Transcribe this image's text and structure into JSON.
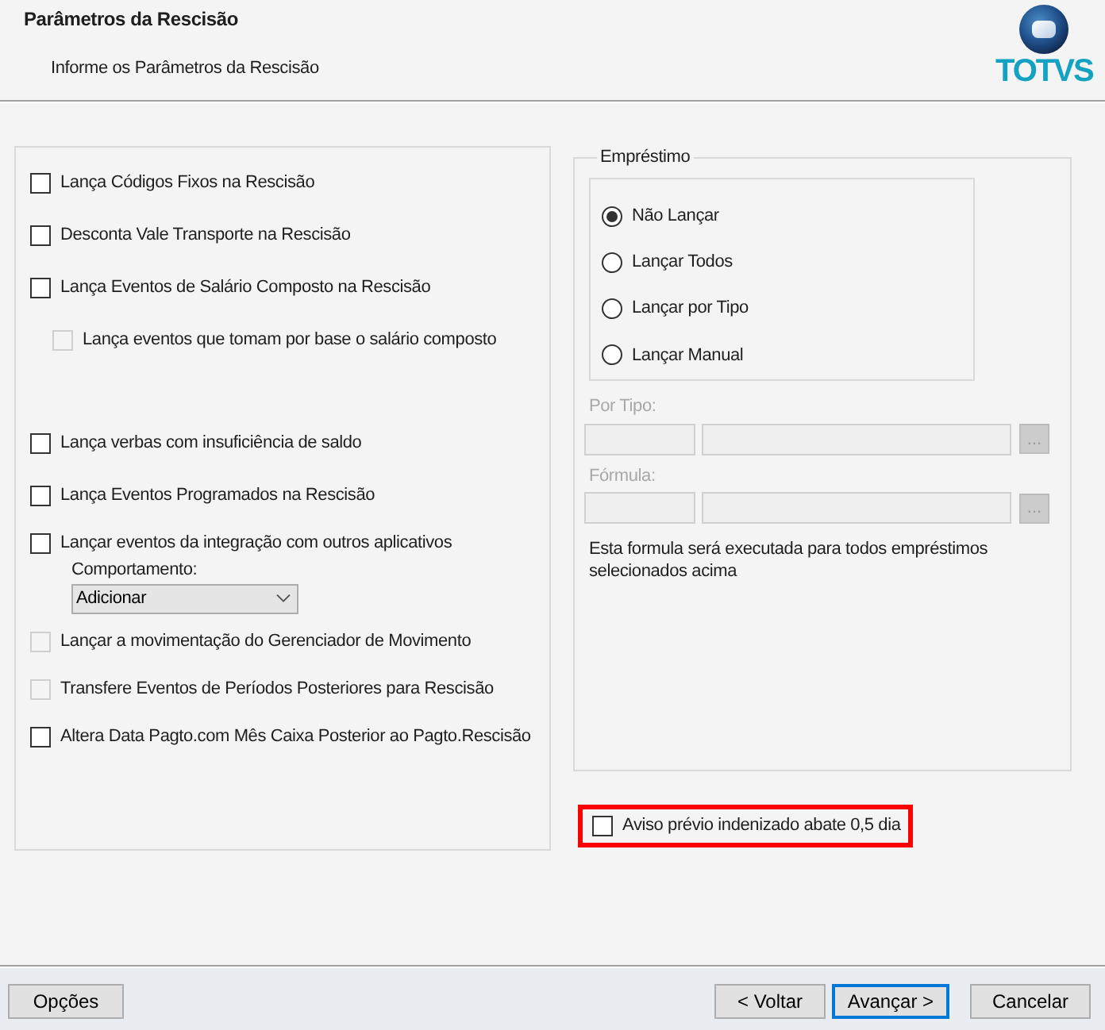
{
  "header": {
    "title": "Parâmetros da Rescisão",
    "subtitle": "Informe os Parâmetros da Rescisão",
    "logo_text": "TOTVS"
  },
  "options": [
    {
      "kind": "checkbox",
      "label": "Lança Códigos Fixos na Rescisão",
      "checked": false,
      "disabled": false
    },
    {
      "kind": "checkbox",
      "label": "Desconta Vale Transporte na Rescisão",
      "checked": false,
      "disabled": false
    },
    {
      "kind": "checkbox",
      "label": "Lança Eventos de Salário Composto na Rescisão",
      "checked": false,
      "disabled": false,
      "children": [
        {
          "kind": "checkbox",
          "label": "Lança eventos que tomam por base o salário composto",
          "checked": false,
          "disabled": true
        }
      ]
    },
    {
      "kind": "checkbox",
      "label": "Lança verbas com insuficiência de saldo",
      "checked": false,
      "disabled": false
    },
    {
      "kind": "checkbox",
      "label": "Lança Eventos Programados na Rescisão",
      "checked": false,
      "disabled": false
    },
    {
      "kind": "checkbox",
      "label": "Lançar eventos da integração com outros aplicativos",
      "checked": false,
      "disabled": false,
      "children": [
        {
          "kind": "dropdown",
          "label": "Comportamento:",
          "value": "Adicionar"
        }
      ]
    },
    {
      "kind": "checkbox",
      "label": "Lançar a movimentação do Gerenciador de Movimento",
      "checked": false,
      "disabled": true
    },
    {
      "kind": "checkbox",
      "label": "Transfere Eventos de Períodos Posteriores para Rescisão",
      "checked": false,
      "disabled": true
    },
    {
      "kind": "checkbox",
      "label": "Altera Data Pagto.com Mês Caixa Posterior ao Pagto.Rescisão",
      "checked": false,
      "disabled": false
    }
  ],
  "loan": {
    "title": "Empréstimo",
    "radios": [
      {
        "label": "Não Lançar",
        "selected": true
      },
      {
        "label": "Lançar Todos",
        "selected": false
      },
      {
        "label": "Lançar por Tipo",
        "selected": false
      },
      {
        "label": "Lançar Manual",
        "selected": false
      }
    ],
    "fields": [
      {
        "label": "Por Tipo:",
        "button": "...",
        "disabled": true
      },
      {
        "label": "Fórmula:",
        "button": "...",
        "disabled": true
      }
    ],
    "note": "Esta formula será executada para todos empréstimos selecionados acima"
  },
  "extra_option": {
    "label": "Aviso prévio indenizado abate 0,5 dia",
    "checked": false,
    "highlighted": true
  },
  "footer": {
    "left_buttons": [
      {
        "label": "Opções",
        "focused": false
      }
    ],
    "right_buttons": [
      {
        "label": "< Voltar",
        "focused": false
      },
      {
        "label": "Avançar >",
        "focused": true
      },
      {
        "label": "Cancelar",
        "focused": false
      }
    ]
  }
}
